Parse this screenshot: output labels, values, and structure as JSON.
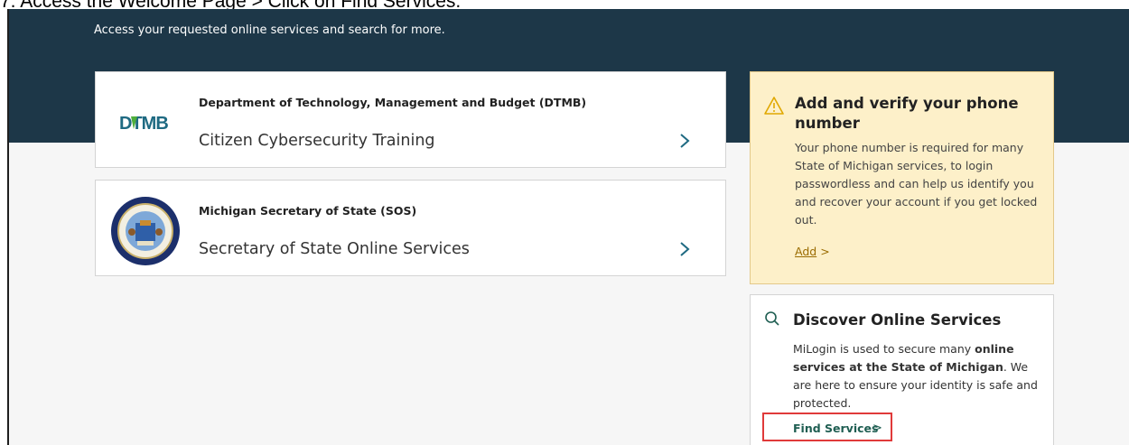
{
  "caption": "7. Access the Welcome Page > Click on Find Services.",
  "hero": {
    "subtitle": "Access your requested online services and search for more."
  },
  "services": [
    {
      "department": "Department of Technology, Management and Budget (DTMB)",
      "name": "Citizen Cybersecurity Training",
      "logo": "DTMB"
    },
    {
      "department": "Michigan Secretary of State (SOS)",
      "name": "Secretary of State Online Services",
      "logo": "michigan-state-seal"
    }
  ],
  "phone_card": {
    "title": "Add and verify your phone number",
    "body": "Your phone number is required for many State of Michigan services, to login passwordless and can help us identify you and recover your account if you get locked out.",
    "link": "Add",
    "icon": "warning-icon",
    "accent": "#e0a800"
  },
  "discover_card": {
    "title": "Discover Online Services",
    "body_1": "MiLogin is used to secure many ",
    "body_bold_1": "online services at the State of Michigan",
    "body_2": ". We are here to ensure your identity is safe and protected.",
    "link": "Find Services",
    "icon": "search-icon",
    "highlight": "#e03a3a"
  },
  "colors": {
    "hero_bg": "#1d3748",
    "link_green": "#1f5e52",
    "chevron": "#1f6a82"
  }
}
